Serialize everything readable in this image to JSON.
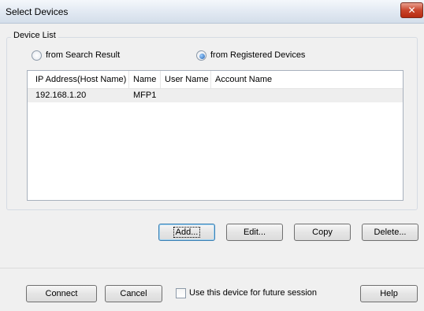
{
  "window": {
    "title": "Select Devices",
    "close_label": "✕"
  },
  "device_list": {
    "group_label": "Device List",
    "radio_search_label": "from Search Result",
    "radio_search_selected": false,
    "radio_registered_label": "from Registered Devices",
    "radio_registered_selected": true,
    "columns": [
      "IP Address(Host Name)",
      "Name",
      "User Name",
      "Account Name"
    ],
    "rows": [
      {
        "ip": "192.168.1.20",
        "name": "MFP1",
        "user": "",
        "account": ""
      }
    ]
  },
  "actions": {
    "add_label": "Add...",
    "edit_label": "Edit...",
    "copy_label": "Copy",
    "delete_label": "Delete..."
  },
  "footer": {
    "connect_label": "Connect",
    "cancel_label": "Cancel",
    "future_session_label": "Use this device for future session",
    "future_session_checked": false,
    "help_label": "Help"
  }
}
